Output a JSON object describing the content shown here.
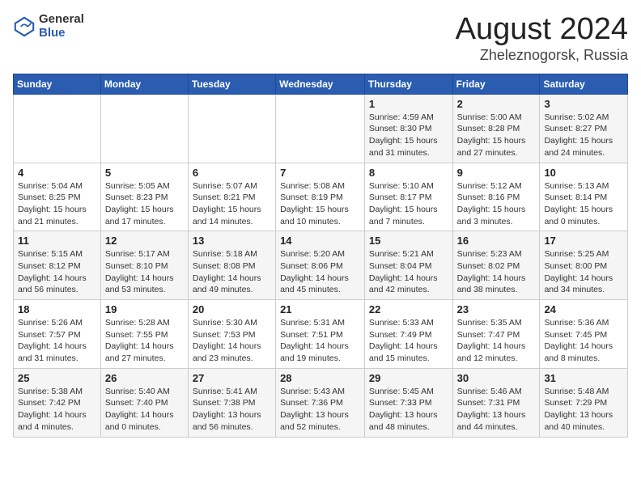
{
  "logo": {
    "general": "General",
    "blue": "Blue"
  },
  "title": "August 2024",
  "subtitle": "Zheleznogorsk, Russia",
  "weekdays": [
    "Sunday",
    "Monday",
    "Tuesday",
    "Wednesday",
    "Thursday",
    "Friday",
    "Saturday"
  ],
  "weeks": [
    [
      {
        "day": "",
        "info": ""
      },
      {
        "day": "",
        "info": ""
      },
      {
        "day": "",
        "info": ""
      },
      {
        "day": "",
        "info": ""
      },
      {
        "day": "1",
        "info": "Sunrise: 4:59 AM\nSunset: 8:30 PM\nDaylight: 15 hours\nand 31 minutes."
      },
      {
        "day": "2",
        "info": "Sunrise: 5:00 AM\nSunset: 8:28 PM\nDaylight: 15 hours\nand 27 minutes."
      },
      {
        "day": "3",
        "info": "Sunrise: 5:02 AM\nSunset: 8:27 PM\nDaylight: 15 hours\nand 24 minutes."
      }
    ],
    [
      {
        "day": "4",
        "info": "Sunrise: 5:04 AM\nSunset: 8:25 PM\nDaylight: 15 hours\nand 21 minutes."
      },
      {
        "day": "5",
        "info": "Sunrise: 5:05 AM\nSunset: 8:23 PM\nDaylight: 15 hours\nand 17 minutes."
      },
      {
        "day": "6",
        "info": "Sunrise: 5:07 AM\nSunset: 8:21 PM\nDaylight: 15 hours\nand 14 minutes."
      },
      {
        "day": "7",
        "info": "Sunrise: 5:08 AM\nSunset: 8:19 PM\nDaylight: 15 hours\nand 10 minutes."
      },
      {
        "day": "8",
        "info": "Sunrise: 5:10 AM\nSunset: 8:17 PM\nDaylight: 15 hours\nand 7 minutes."
      },
      {
        "day": "9",
        "info": "Sunrise: 5:12 AM\nSunset: 8:16 PM\nDaylight: 15 hours\nand 3 minutes."
      },
      {
        "day": "10",
        "info": "Sunrise: 5:13 AM\nSunset: 8:14 PM\nDaylight: 15 hours\nand 0 minutes."
      }
    ],
    [
      {
        "day": "11",
        "info": "Sunrise: 5:15 AM\nSunset: 8:12 PM\nDaylight: 14 hours\nand 56 minutes."
      },
      {
        "day": "12",
        "info": "Sunrise: 5:17 AM\nSunset: 8:10 PM\nDaylight: 14 hours\nand 53 minutes."
      },
      {
        "day": "13",
        "info": "Sunrise: 5:18 AM\nSunset: 8:08 PM\nDaylight: 14 hours\nand 49 minutes."
      },
      {
        "day": "14",
        "info": "Sunrise: 5:20 AM\nSunset: 8:06 PM\nDaylight: 14 hours\nand 45 minutes."
      },
      {
        "day": "15",
        "info": "Sunrise: 5:21 AM\nSunset: 8:04 PM\nDaylight: 14 hours\nand 42 minutes."
      },
      {
        "day": "16",
        "info": "Sunrise: 5:23 AM\nSunset: 8:02 PM\nDaylight: 14 hours\nand 38 minutes."
      },
      {
        "day": "17",
        "info": "Sunrise: 5:25 AM\nSunset: 8:00 PM\nDaylight: 14 hours\nand 34 minutes."
      }
    ],
    [
      {
        "day": "18",
        "info": "Sunrise: 5:26 AM\nSunset: 7:57 PM\nDaylight: 14 hours\nand 31 minutes."
      },
      {
        "day": "19",
        "info": "Sunrise: 5:28 AM\nSunset: 7:55 PM\nDaylight: 14 hours\nand 27 minutes."
      },
      {
        "day": "20",
        "info": "Sunrise: 5:30 AM\nSunset: 7:53 PM\nDaylight: 14 hours\nand 23 minutes."
      },
      {
        "day": "21",
        "info": "Sunrise: 5:31 AM\nSunset: 7:51 PM\nDaylight: 14 hours\nand 19 minutes."
      },
      {
        "day": "22",
        "info": "Sunrise: 5:33 AM\nSunset: 7:49 PM\nDaylight: 14 hours\nand 15 minutes."
      },
      {
        "day": "23",
        "info": "Sunrise: 5:35 AM\nSunset: 7:47 PM\nDaylight: 14 hours\nand 12 minutes."
      },
      {
        "day": "24",
        "info": "Sunrise: 5:36 AM\nSunset: 7:45 PM\nDaylight: 14 hours\nand 8 minutes."
      }
    ],
    [
      {
        "day": "25",
        "info": "Sunrise: 5:38 AM\nSunset: 7:42 PM\nDaylight: 14 hours\nand 4 minutes."
      },
      {
        "day": "26",
        "info": "Sunrise: 5:40 AM\nSunset: 7:40 PM\nDaylight: 14 hours\nand 0 minutes."
      },
      {
        "day": "27",
        "info": "Sunrise: 5:41 AM\nSunset: 7:38 PM\nDaylight: 13 hours\nand 56 minutes."
      },
      {
        "day": "28",
        "info": "Sunrise: 5:43 AM\nSunset: 7:36 PM\nDaylight: 13 hours\nand 52 minutes."
      },
      {
        "day": "29",
        "info": "Sunrise: 5:45 AM\nSunset: 7:33 PM\nDaylight: 13 hours\nand 48 minutes."
      },
      {
        "day": "30",
        "info": "Sunrise: 5:46 AM\nSunset: 7:31 PM\nDaylight: 13 hours\nand 44 minutes."
      },
      {
        "day": "31",
        "info": "Sunrise: 5:48 AM\nSunset: 7:29 PM\nDaylight: 13 hours\nand 40 minutes."
      }
    ]
  ]
}
